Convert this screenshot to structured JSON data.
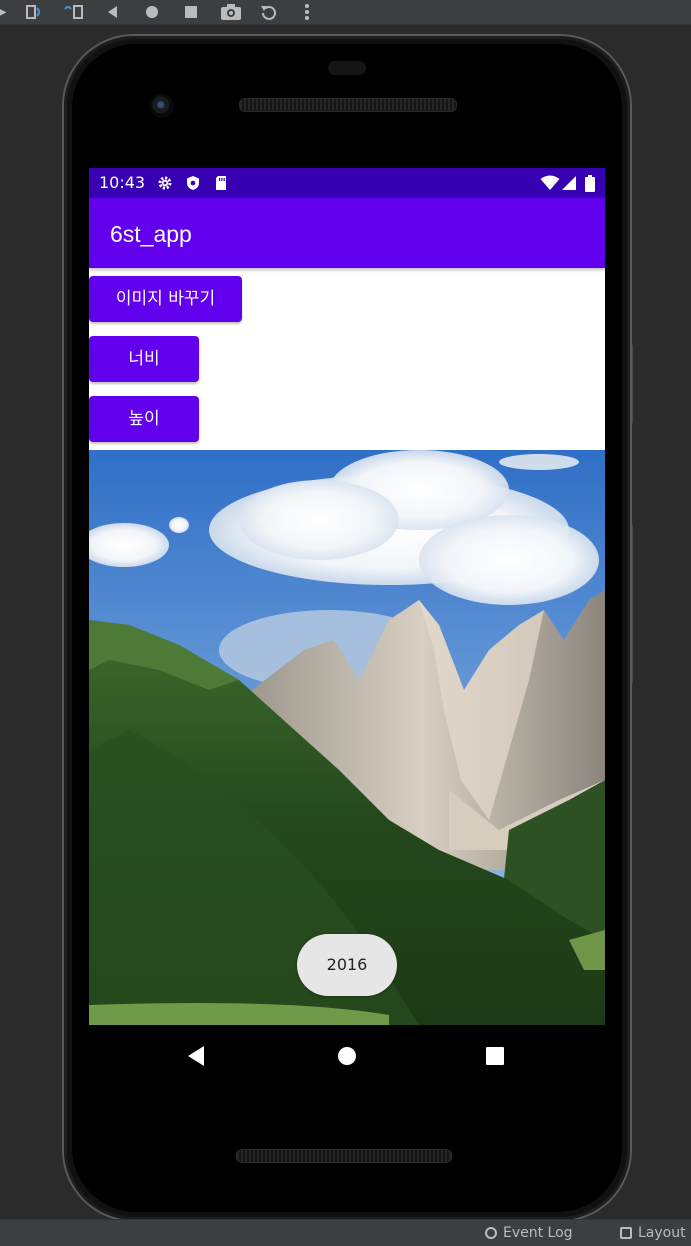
{
  "ide": {
    "toolbar_icons": [
      "run-icon",
      "apply-changes-icon",
      "apply-code-changes-icon",
      "back-icon",
      "home-icon",
      "overview-icon",
      "screenshot-icon",
      "rotate-icon",
      "more-icon"
    ],
    "bottom_bar": {
      "event_log": "Event Log",
      "layout": "Layout"
    }
  },
  "status_bar": {
    "time": "10:43",
    "color": "#3700b3",
    "left_icons": [
      "settings-icon",
      "shield-icon",
      "sd-card-icon"
    ],
    "right_icons": [
      "wifi-icon",
      "signal-icon",
      "battery-icon"
    ]
  },
  "app_bar": {
    "title": "6st_app",
    "color": "#6200ee"
  },
  "buttons": {
    "change_image": "이미지 바꾸기",
    "width": "너비",
    "height": "높이"
  },
  "image": {
    "description_icon": "mountain-landscape-image"
  },
  "toast": {
    "text": "2016"
  },
  "nav_bar": {
    "icons": [
      "back-triangle-icon",
      "home-circle-icon",
      "recents-square-icon"
    ]
  }
}
